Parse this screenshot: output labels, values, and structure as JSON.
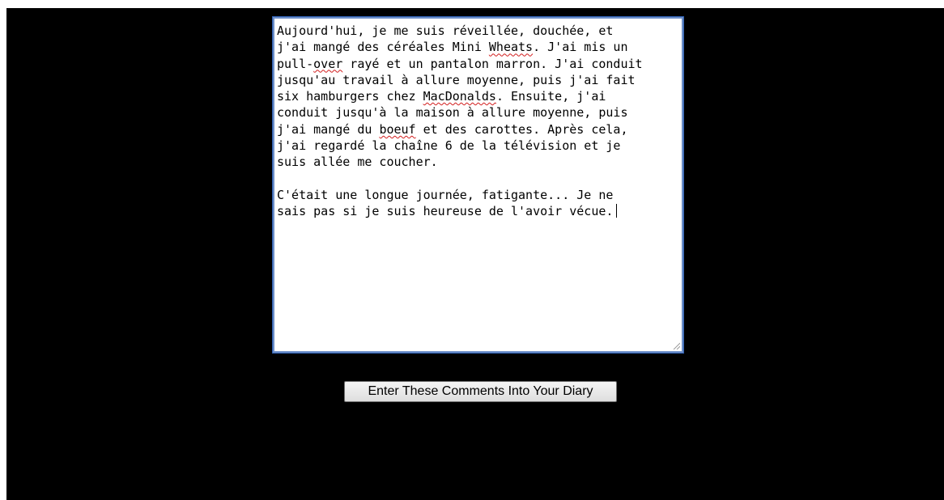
{
  "diary": {
    "p1_a": "Aujourd'hui, je me suis réveillée, douchée, et\nj'ai mangé des céréales Mini ",
    "w_wheats": "Wheats",
    "p1_b": ". J'ai mis un\npull-",
    "w_over": "over",
    "p1_c": " rayé et un pantalon marron. J'ai conduit\njusqu'au travail à allure moyenne, puis j'ai fait\nsix hamburgers chez ",
    "w_macdonalds": "MacDonalds",
    "p1_d": ". Ensuite, j'ai\nconduit jusqu'à la maison à allure moyenne, puis\nj'ai mangé du ",
    "w_boeuf": "boeuf",
    "p1_e": " et des carottes. Après cela,\nj'ai regardé la chaîne 6 de la télévision et je\nsuis allée me coucher.\n\nC'était une longue journée, fatigante... Je ne\nsais pas si je suis heureuse de l'avoir vécue."
  },
  "submit": {
    "label": "Enter These Comments Into Your Diary"
  },
  "colors": {
    "page_background": "#000000",
    "textarea_border": "#6d8fc9",
    "spellcheck_underline": "#d21d1d"
  },
  "icons": {
    "resize": "resize-grip-icon"
  }
}
